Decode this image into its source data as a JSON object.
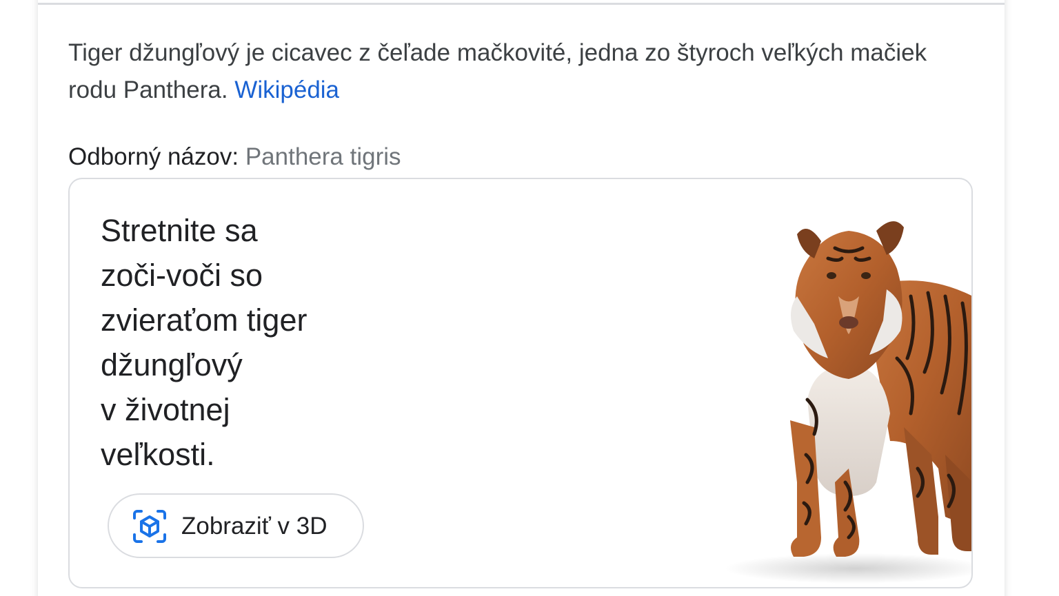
{
  "knowledge_panel": {
    "description_text": "Tiger džungľový je cicavec z čeľade mačkovité, jedna zo štyroch veľkých mačiek rodu Panthera.",
    "source_link": "Wikipédia",
    "scientific_name_label": "Odborný názov:",
    "scientific_name_value": "Panthera tigris"
  },
  "ar_card": {
    "headline": "Stretnite sa\nzoči-voči so\nzvieraťom tiger\ndžungľový\nv životnej\nveľkosti.",
    "button_label": "Zobraziť v 3D",
    "button_icon": "view-in-3d-icon",
    "accent_color": "#1a73e8"
  }
}
